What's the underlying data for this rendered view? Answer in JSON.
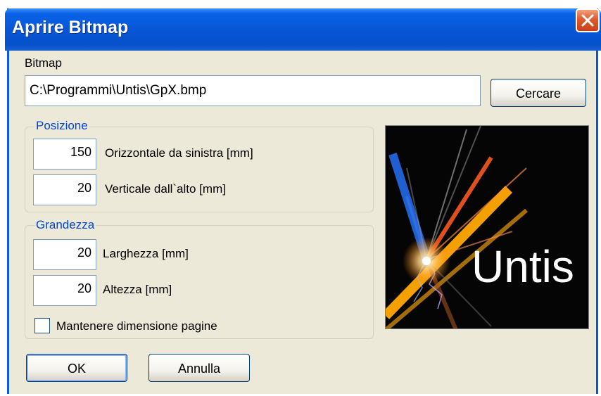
{
  "window": {
    "title": "Aprire Bitmap"
  },
  "bitmap": {
    "label": "Bitmap",
    "path_value": "C:\\Programmi\\Untis\\GpX.bmp",
    "browse_label": "Cercare"
  },
  "position": {
    "group_label": "Posizione",
    "horizontal_value": "150",
    "horizontal_label": "Orizzontale da sinistra [mm]",
    "vertical_value": "20",
    "vertical_label": "Verticale dall`alto [mm]"
  },
  "size": {
    "group_label": "Grandezza",
    "width_value": "20",
    "width_label": "Larghezza [mm]",
    "height_value": "20",
    "height_label": "Altezza [mm]",
    "keep_label": "Mantenere dimensione pagine",
    "keep_checked": false
  },
  "preview": {
    "logo_text": "Untis"
  },
  "buttons": {
    "ok_label": "OK",
    "cancel_label": "Annulla"
  },
  "colors": {
    "titlebar": "#0856d6",
    "group_label": "#0046d5",
    "close": "#e05a2a",
    "dialog_bg": "#ece9d8"
  },
  "icons": {
    "close": "close-icon"
  }
}
